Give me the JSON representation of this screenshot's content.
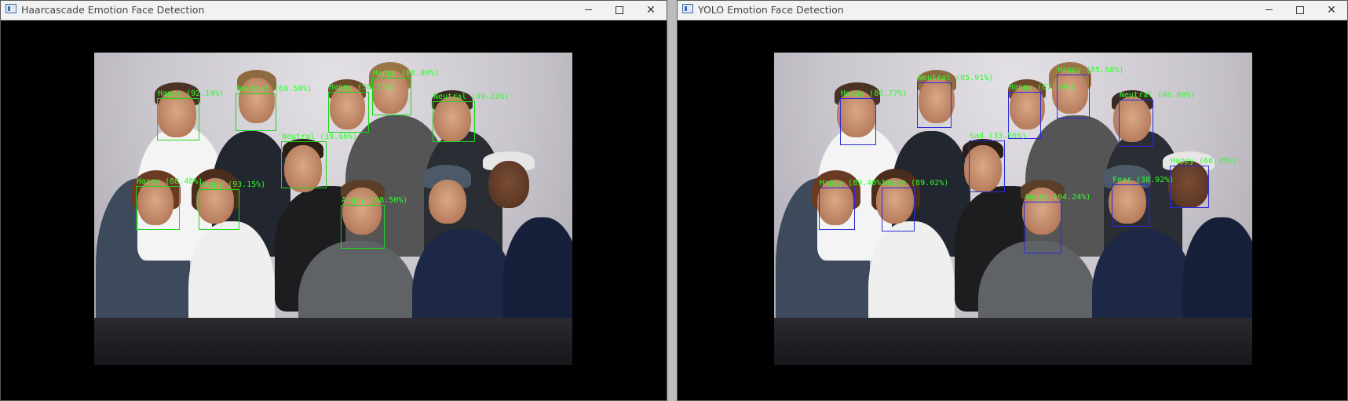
{
  "windows": [
    {
      "id": "left",
      "title": "Haarcascade Emotion Face Detection",
      "detections": [
        {
          "label": "Happy (92.14%)"
        },
        {
          "label": "Neutral (69.58%)"
        },
        {
          "label": "Happy (58.71%)"
        },
        {
          "label": "Happy (88.88%)"
        },
        {
          "label": "Neutral (49.23%)"
        },
        {
          "label": "Neutral (39.66%)"
        },
        {
          "label": "Happy (88.48%)"
        },
        {
          "label": "Happy (93.15%)"
        },
        {
          "label": "Angry (98.50%)"
        }
      ]
    },
    {
      "id": "right",
      "title": "YOLO Emotion Face Detection",
      "detections": [
        {
          "label": "Happy (86.77%)"
        },
        {
          "label": "Neutral (85.91%)"
        },
        {
          "label": "Happy (67.24%)"
        },
        {
          "label": "Happy (85.68%)"
        },
        {
          "label": "Neutral (46.09%)"
        },
        {
          "label": "Sad (33.56%)"
        },
        {
          "label": "Happy (68.35%)"
        },
        {
          "label": "Happy (89.40%)"
        },
        {
          "label": "Happy (89.02%)"
        },
        {
          "label": "Angry (94.24%)"
        },
        {
          "label": "Fear (38.92%)"
        }
      ]
    }
  ],
  "colors": {
    "haar_box": "#1bd61b",
    "yolo_box": "#2b2bd8",
    "label_text": "#2dff2d"
  },
  "icons": {
    "minimize": "minimize-icon",
    "maximize": "maximize-icon",
    "close": "close-icon"
  }
}
